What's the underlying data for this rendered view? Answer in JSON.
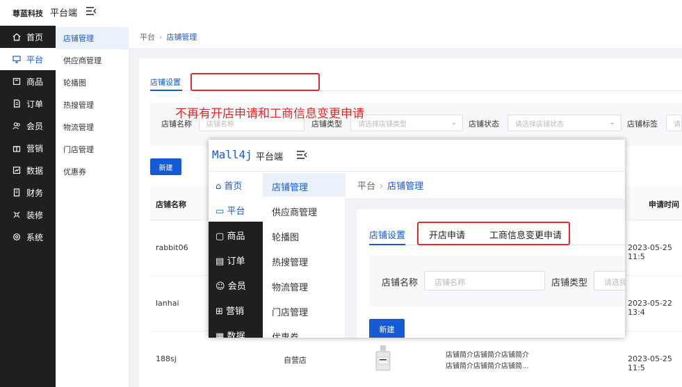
{
  "header": {
    "brand": "尊蓝科技",
    "platform": "平台端"
  },
  "sidebar": [
    {
      "label": "首页",
      "icon": "home-icon"
    },
    {
      "label": "平台",
      "icon": "monitor-icon"
    },
    {
      "label": "商品",
      "icon": "box-icon"
    },
    {
      "label": "订单",
      "icon": "document-icon"
    },
    {
      "label": "会员",
      "icon": "users-icon"
    },
    {
      "label": "营销",
      "icon": "gift-icon"
    },
    {
      "label": "数据",
      "icon": "chart-icon"
    },
    {
      "label": "财务",
      "icon": "finance-icon"
    },
    {
      "label": "装修",
      "icon": "decor-icon"
    },
    {
      "label": "系统",
      "icon": "gear-icon"
    }
  ],
  "subnav": [
    "店铺管理",
    "供应商管理",
    "轮播图",
    "热搜管理",
    "物流管理",
    "门店管理",
    "优惠券"
  ],
  "breadcrumb": {
    "root": "平台",
    "current": "店铺管理"
  },
  "tabs": {
    "active": "店铺设置"
  },
  "annotation": "不再有开店申请和工商信息变更申请",
  "filters": {
    "shop_name_label": "店铺名称",
    "shop_name_placeholder": "店铺名称",
    "shop_type_label": "店铺类型",
    "shop_type_placeholder": "请选择店铺类型",
    "shop_status_label": "店铺状态",
    "shop_status_placeholder": "请选择店铺状态",
    "shop_tag_label": "店铺标签",
    "shop_tag_placeholder": "请"
  },
  "new_button": "新建",
  "table": {
    "col_name": "店铺名称",
    "col_time": "申请时间",
    "rows": [
      {
        "name": "rabbit06",
        "time": "2023-05-25 11:5"
      },
      {
        "name": "lanhai",
        "time": "2023-05-22 13:4"
      },
      {
        "name": "188sj",
        "type": "自营店",
        "intro1": "店铺简介店铺简介店铺简介",
        "intro2": "店铺简介店铺简介店铺简...",
        "time": "2023-05-25 11:5"
      }
    ]
  },
  "inset": {
    "logo": "Mall4j",
    "platform": "平台端",
    "sidebar": [
      "首页",
      "平台",
      "商品",
      "订单",
      "会员",
      "营销",
      "数据"
    ],
    "subnav": [
      "店铺管理",
      "供应商管理",
      "轮播图",
      "热搜管理",
      "物流管理",
      "门店管理",
      "优惠券"
    ],
    "breadcrumb_root": "平台",
    "breadcrumb_current": "店铺管理",
    "tabs": [
      "店铺设置",
      "开店申请",
      "工商信息变更申请"
    ],
    "filter_name_label": "店铺名称",
    "filter_name_placeholder": "店铺名称",
    "filter_type_label": "店铺类型",
    "filter_type_placeholder": "请选择",
    "new_button": "新建"
  },
  "colors": {
    "primary": "#155bd4",
    "annotation": "#e12b2b",
    "sidebar_bg": "#1f1f1f"
  }
}
